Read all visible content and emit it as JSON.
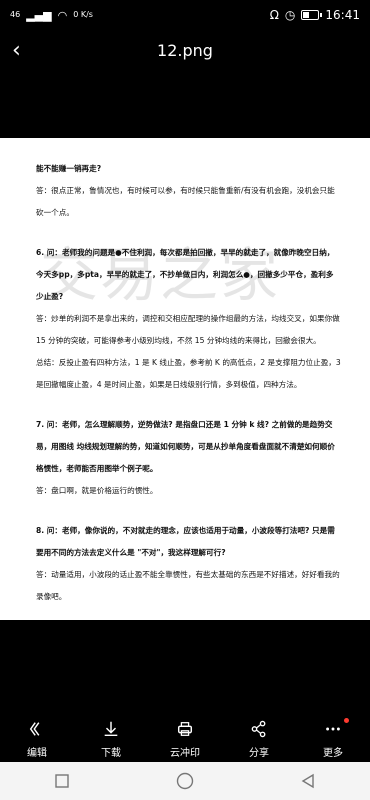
{
  "status": {
    "signal": "46",
    "speed": "0 K/s",
    "time": "16:41",
    "battery_level": 0.4
  },
  "header": {
    "title": "12.png"
  },
  "document": {
    "lines": [
      {
        "style": "q",
        "text": "能不能赚一销再走?"
      },
      {
        "style": "a",
        "text": "答：很点正常，鲁情况也，有时候可以参，有时候只能鲁重新/有没有机会跑，没机会只能"
      },
      {
        "style": "a",
        "text": "砍一个点。"
      },
      {
        "style": "gap",
        "text": ""
      },
      {
        "style": "q",
        "text": "6.  问：老师我的问题是●不住利润，每次都是拍回撤，早早的就走了，就像昨晚空日纳，"
      },
      {
        "style": "q",
        "text": "今天多pp，多pta，早早的就走了，不抄单做日内，利润怎么●，回撤多少平仓，盈利多"
      },
      {
        "style": "q",
        "text": "少止盈?"
      },
      {
        "style": "a",
        "text": "答：炒单的利润不是拿出来的，调控和交相应配理的操作组最的方法，均线交叉，如果你做"
      },
      {
        "style": "a",
        "text": "15 分钟的突破，可能得参考小级别均线，不然 15 分钟均线的来得比，回撤会很大。"
      },
      {
        "style": "a",
        "text": "总结：反投止盈有四种方法，1 是 K 线止盈，参考前 K 的高低点，2 是支撑阻力位止盈，3"
      },
      {
        "style": "a",
        "text": "是回撤幅度止盈，4 是时间止盈，如果是日线级别行情，多到极值，四种方法。"
      },
      {
        "style": "gap",
        "text": ""
      },
      {
        "style": "q",
        "text": "7.  问：老师，怎么理解顺势，逆势做法?  是指盘口还是 1 分钟 k 线? 之前做的是趋势交"
      },
      {
        "style": "q",
        "text": "易，用图线  均线规划理解的势，知道如何顺势，可是从抄单角度看盘面就不清楚如何顺价"
      },
      {
        "style": "q",
        "text": "格惯性，老师能否用图举个例子呢。"
      },
      {
        "style": "a",
        "text": "答：盘口啊，就是价格运行的惯性。"
      },
      {
        "style": "gap",
        "text": ""
      },
      {
        "style": "q",
        "text": "8.  问：老师，像你说的，不对就走的理念，应该也适用于动量，小波段等打法吧? 只是需"
      },
      {
        "style": "q",
        "text": "要用不同的方法去定义什么是 \"不对\"，我这样理解可行?"
      },
      {
        "style": "a",
        "text": "答：动量适用，小波段的话止盈不能全靠惯性，有些太基础的东西是不好描述，好好看我的"
      },
      {
        "style": "a",
        "text": "录像吧。"
      }
    ],
    "watermark": "交易之家"
  },
  "toolbar": {
    "edit": "编辑",
    "download": "下载",
    "print": "云冲印",
    "share": "分享",
    "more": "更多"
  }
}
